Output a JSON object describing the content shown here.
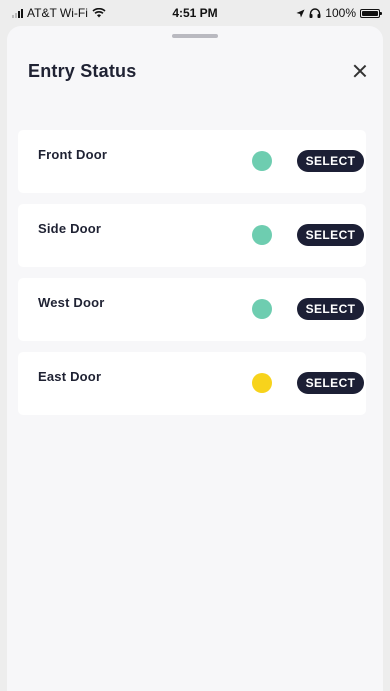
{
  "status_bar": {
    "carrier": "AT&T Wi-Fi",
    "time": "4:51 PM",
    "battery": "100%",
    "icons": [
      "signal-icon",
      "wifi-icon",
      "location-arrow-icon",
      "headphones-icon",
      "battery-icon"
    ]
  },
  "sheet": {
    "title": "Entry Status",
    "close_icon": "close-icon"
  },
  "doors": [
    {
      "name": "Front Door",
      "status_color": "#6ecdb0",
      "button_label": "SELECT"
    },
    {
      "name": "Side Door",
      "status_color": "#6ecdb0",
      "button_label": "SELECT"
    },
    {
      "name": "West Door",
      "status_color": "#6ecdb0",
      "button_label": "SELECT"
    },
    {
      "name": "East Door",
      "status_color": "#f7d31c",
      "button_label": "SELECT"
    }
  ],
  "colors": {
    "button_bg": "#1c1f35",
    "sheet_bg": "#f7f7f9",
    "card_bg": "#ffffff"
  }
}
